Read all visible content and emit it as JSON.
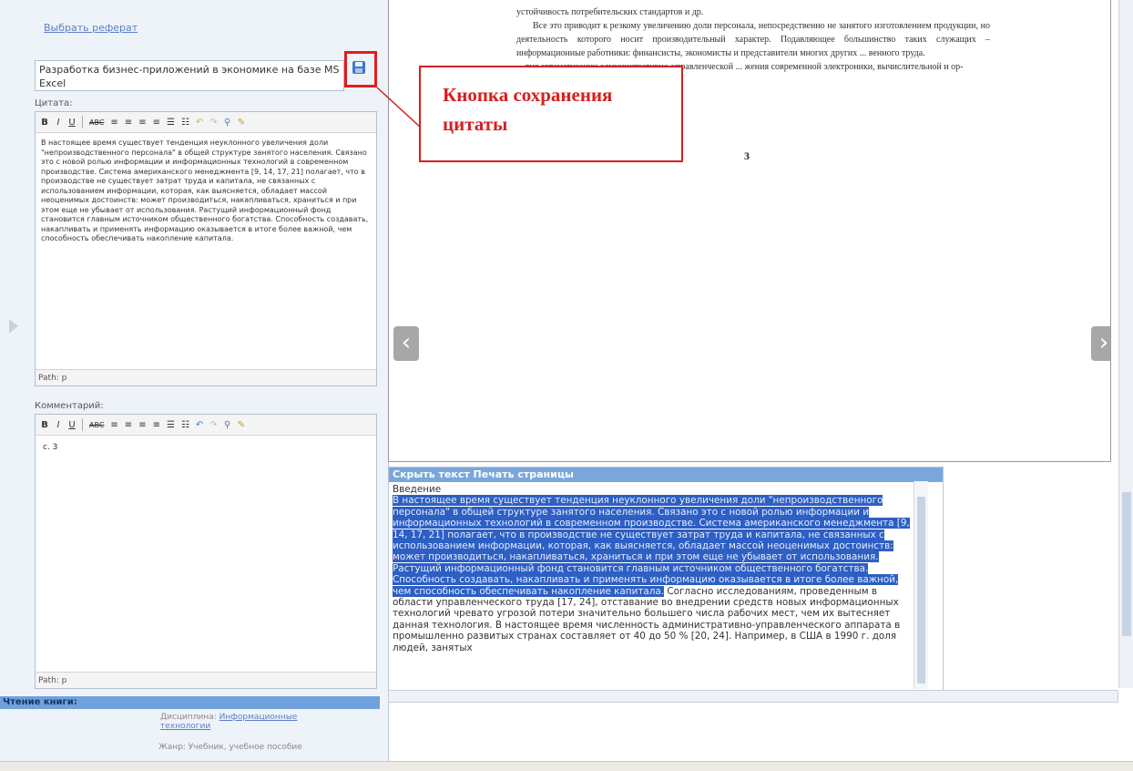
{
  "left_panel": {
    "choose_link": "Выбрать реферат",
    "ref_title": "Разработка бизнес-приложений в экономике на базе MS Excel",
    "quote_label": "Цитата:",
    "quote_text": "В настоящее время существует тенденция неуклонного увеличения доли \"непроизводственного персонала\" в общей структуре занятого населения. Связано это с новой ролью информации и информационных технологий в современном производстве. Система американского менеджмента [9, 14, 17, 21] полагает, что в производстве не существует затрат труда и капитала, не связанных с использованием информации, которая, как выясняется, обладает массой неоценимых достоинств: может производиться, накапливаться, храниться и при этом еще не убывает от использования. Растущий информационный фонд становится главным источником общественного богатства. Способность создавать, накапливать и применять информацию оказывается в итоге более важной, чем способность обеспечивать накопление капитала.",
    "path_quote": "Path: p",
    "comment_label": "Комментарий:",
    "comment_text": "с. 3",
    "path_comment": "Path: p",
    "reading_bar": "Чтение книги:",
    "discipline_label": "Дисциплина:",
    "discipline_link": "Информационные технологии",
    "genre": "Жанр: Учебник, учебное пособие"
  },
  "toolbar": {
    "bold": "B",
    "italic": "I",
    "underline": "U",
    "strike": "ABC",
    "align_left": "≡",
    "align_center": "≡",
    "align_right": "≡",
    "align_justify": "≡",
    "bullets": "☰",
    "numbers": "☷",
    "undo": "↶",
    "redo": "↷",
    "find": "⚲",
    "spell": "✎"
  },
  "viewer": {
    "page_text_1": "устойчивость потребительских стандартов и др.",
    "page_text_2": "Все это приводит к резкому увеличению доли персонала, непосредственно не занятого изготовлением продукции, но деятельность которого носит производительный характер. Подавляющее большинство таких служащих – информационные работники: финансисты, экономисты и представители многих других ... венного труда.",
    "page_text_3": "... тия автоматизации административно-управленческой ... жения современной электроники, вычислительной и ор-",
    "page_number": "3",
    "prev_glyph": "‹",
    "next_glyph": "›"
  },
  "text_panel": {
    "header": "Скрыть текст Печать страницы",
    "heading": "Введение",
    "highlighted": "В настоящее время существует тенденция неуклонного увеличения доли \"непроизводственного персонала\" в общей структуре занятого населения. Связано это с новой ролью информации и информационных технологий в современном производстве. Система американского менеджмента [9, 14, 17, 21] полагает, что в производстве не существует затрат труда и капитала, не связанных с использованием информации, которая, как выясняется, обладает массой неоценимых достоинств: может производиться, накапливаться, храниться и при этом еще не убывает от использования. Растущий информационный фонд становится главным источником общественного богатства. Способность создавать, накапливать и применять информацию оказывается в итоге более важной, чем способность обеспечивать накопление капитала.",
    "rest": " Согласно исследованиям, проведенным в области управленческого труда [17, 24], отставание во внедрении средств новых информационных технологий чревато угрозой потери значительно большего числа рабочих мест, чем их вытесняет данная технология. В настоящее время численность административно-управленческого аппарата в промышленно развитых странах составляет от 40 до 50 % [20, 24]. Например, в США в 1990 г. доля людей, занятых"
  },
  "annotation": {
    "callout": "Кнопка сохранения цитаты",
    "color": "#d42020"
  }
}
